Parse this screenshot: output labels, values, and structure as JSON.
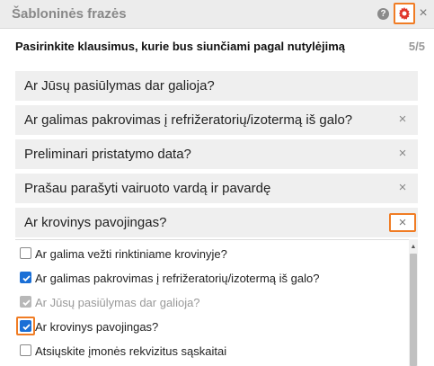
{
  "header": {
    "title": "Šabloninės frazės",
    "help_label": "?",
    "close_label": "×",
    "accent": "#f07c24"
  },
  "subtitle": "Pasirinkite klausimus, kurie bus siunčiami pagal nutylėjimą",
  "count": "5/5",
  "selected": [
    {
      "label": "Ar Jūsų pasiūlymas dar galioja?",
      "removable": false
    },
    {
      "label": "Ar galimas pakrovimas į refrižeratorių/izotermą iš galo?",
      "removable": true
    },
    {
      "label": "Preliminari pristatymo data?",
      "removable": true
    },
    {
      "label": "Prašau parašyti vairuoto vardą ir pavardę",
      "removable": true
    },
    {
      "label": "Ar krovinys pavojingas?",
      "removable": true,
      "highlighted": true
    }
  ],
  "remove_glyph": "×",
  "options": [
    {
      "label": "Ar galima vežti rinktiniame krovinyje?",
      "state": "unchecked"
    },
    {
      "label": "Ar galimas pakrovimas į refrižeratorių/izotermą iš galo?",
      "state": "checked"
    },
    {
      "label": "Ar Jūsų pasiūlymas dar galioja?",
      "state": "disabled-checked"
    },
    {
      "label": "Ar krovinys pavojingas?",
      "state": "checked",
      "highlighted": true
    },
    {
      "label": "Atsiųskite įmonės rekvizitus sąskaitai",
      "state": "unchecked"
    }
  ],
  "colors": {
    "checkbox_checked": "#1a6fd6",
    "highlight": "#f07c24"
  }
}
